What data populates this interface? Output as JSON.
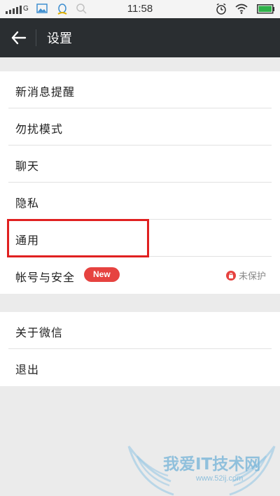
{
  "status_bar": {
    "network": "G",
    "time": "11:58"
  },
  "header": {
    "title": "设置"
  },
  "settings_groups": [
    {
      "items": [
        {
          "label": "新消息提醒"
        },
        {
          "label": "勿扰模式"
        },
        {
          "label": "聊天"
        },
        {
          "label": "隐私"
        },
        {
          "label": "通用"
        },
        {
          "label": "帐号与安全",
          "badge": "New",
          "status": "未保护"
        }
      ]
    },
    {
      "items": [
        {
          "label": "关于微信"
        },
        {
          "label": "退出"
        }
      ]
    }
  ],
  "watermark": {
    "text": "我爱IT技术网",
    "url": "www.52ij.com"
  },
  "colors": {
    "navbar": "#2a2e31",
    "badge": "#e64340",
    "highlight": "#e02020",
    "background": "#ebebeb"
  }
}
